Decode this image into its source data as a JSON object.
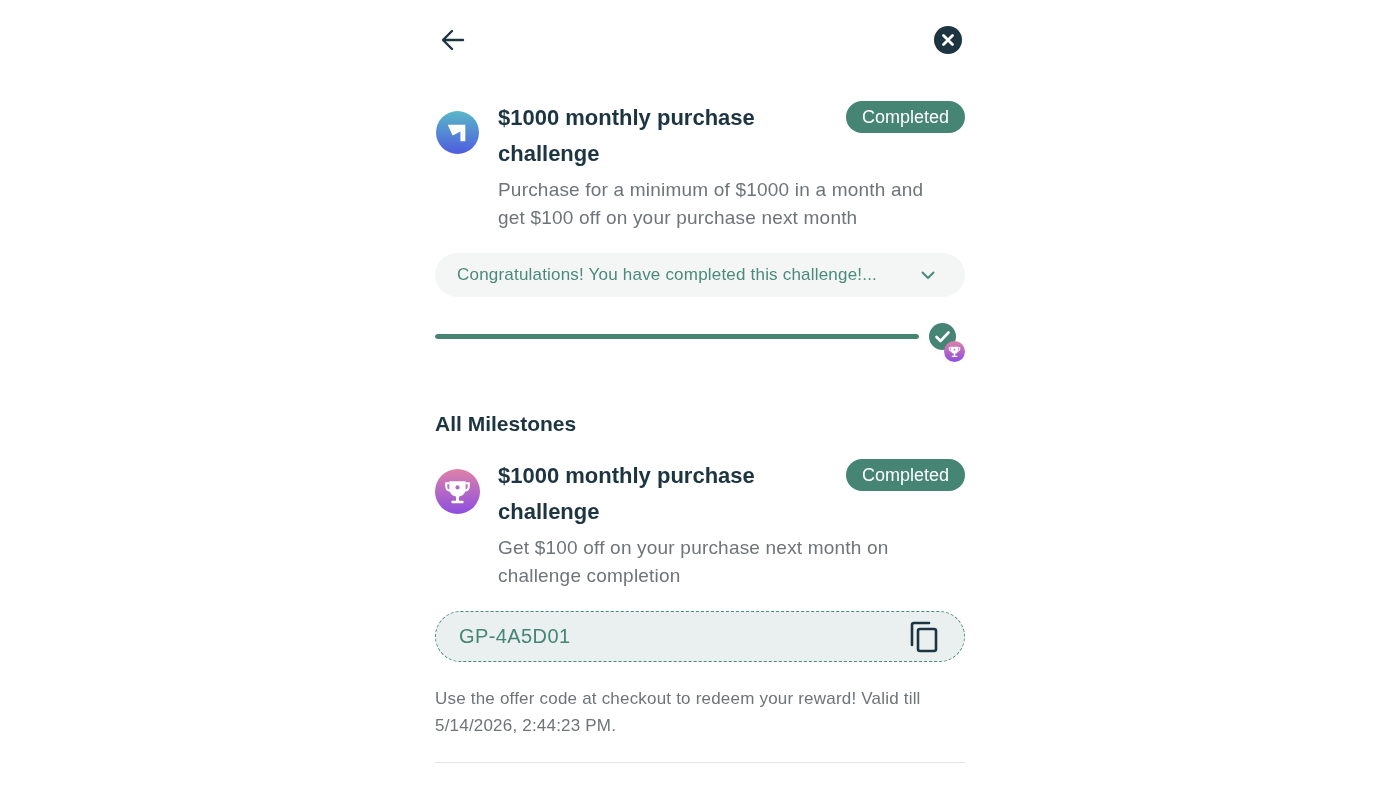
{
  "challenge": {
    "title": "$1000 monthly purchase challenge",
    "status": "Completed",
    "description": "Purchase for a minimum of $1000 in a month and get $100 off on your purchase next month",
    "message": {
      "text": "Congratulations! You have completed this challenge!...",
      "expanded": false
    },
    "progress": {
      "level": 1,
      "completed": true
    }
  },
  "milestones": {
    "heading": "All Milestones",
    "items": [
      {
        "title": "$1000 monthly purchase challenge",
        "status": "Completed",
        "description": "Get $100 off on your purchase next month on challenge completion",
        "code": "GP-4A5D01",
        "note": "Use the offer code at checkout to redeem your reward! Valid till 5/14/2026, 2:44:23 PM."
      }
    ]
  }
}
